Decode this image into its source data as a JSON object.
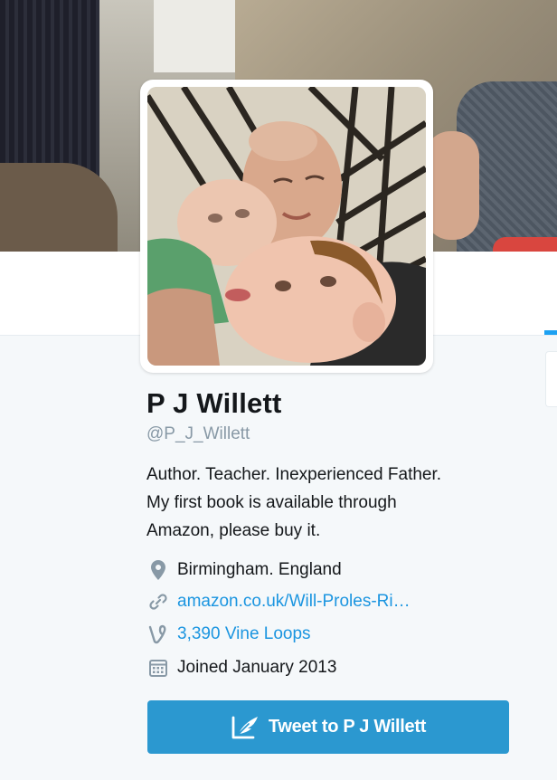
{
  "profile": {
    "name": "P J Willett",
    "handle": "@P_J_Willett",
    "bio_lines": [
      "Author. Teacher. Inexperienced Father.",
      "My first book is available through",
      "Amazon, please buy it."
    ],
    "location": "Birmingham. England",
    "website": "amazon.co.uk/Will-Proles-Ri…",
    "vine_loops": "3,390 Vine Loops",
    "joined": "Joined January 2013"
  },
  "actions": {
    "tweet_to_label": "Tweet to P J Willett"
  },
  "icons": {
    "location": "location-pin-icon",
    "website": "link-icon",
    "vine": "vine-icon",
    "joined": "calendar-icon",
    "tweet": "compose-quill-icon"
  },
  "colors": {
    "link": "#1b95e0",
    "button": "#2b98d0",
    "muted": "#8899a6",
    "accent": "#1da1f2"
  }
}
